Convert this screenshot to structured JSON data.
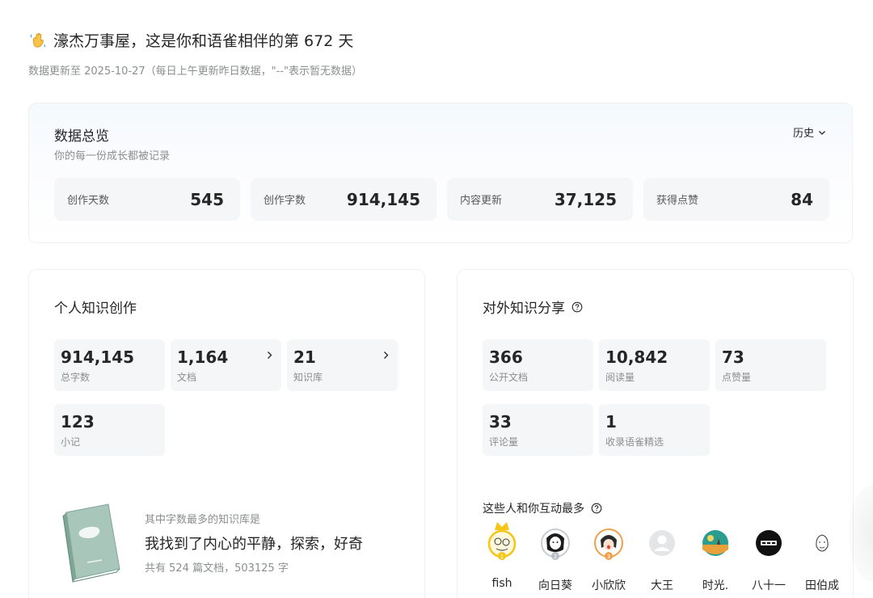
{
  "greeting": {
    "icon": "waving-hand-icon",
    "text": "濠杰万事屋，这是你和语雀相伴的第 672 天"
  },
  "update_note": "数据更新至 2025-10-27（每日上午更新昨日数据，\"--\"表示暂无数据）",
  "overview": {
    "title": "数据总览",
    "subtitle": "你的每一份成长都被记录",
    "history_label": "历史",
    "stats": [
      {
        "label": "创作天数",
        "value": "545"
      },
      {
        "label": "创作字数",
        "value": "914,145"
      },
      {
        "label": "内容更新",
        "value": "37,125"
      },
      {
        "label": "获得点赞",
        "value": "84"
      }
    ]
  },
  "personal": {
    "title": "个人知识创作",
    "tiles": [
      {
        "value": "914,145",
        "label": "总字数",
        "link": false
      },
      {
        "value": "1,164",
        "label": "文档",
        "link": true
      },
      {
        "value": "21",
        "label": "知识库",
        "link": true
      },
      {
        "value": "123",
        "label": "小记",
        "link": false
      }
    ],
    "top_kb": {
      "caption": "其中字数最多的知识库是",
      "name": "我找到了内心的平静，探索，好奇",
      "meta": "共有 524 篇文档，503125 字"
    }
  },
  "sharing": {
    "title": "对外知识分享",
    "tiles": [
      {
        "value": "366",
        "label": "公开文档"
      },
      {
        "value": "10,842",
        "label": "阅读量"
      },
      {
        "value": "73",
        "label": "点赞量"
      },
      {
        "value": "33",
        "label": "评论量"
      },
      {
        "value": "1",
        "label": "收录语雀精选"
      }
    ],
    "interact_title": "这些人和你互动最多",
    "people": [
      {
        "name": "fish",
        "rank": "1"
      },
      {
        "name": "向日葵",
        "rank": "2"
      },
      {
        "name": "小欣欣",
        "rank": "3"
      },
      {
        "name": "大王",
        "rank": ""
      },
      {
        "name": "时光.",
        "rank": ""
      },
      {
        "name": "八十一",
        "rank": ""
      },
      {
        "name": "田伯成",
        "rank": ""
      }
    ]
  },
  "colors": {
    "text_primary": "#262626",
    "text_secondary": "#8a8f8d",
    "tile_bg": "#f5f6f7",
    "gold": "#f5c518"
  }
}
